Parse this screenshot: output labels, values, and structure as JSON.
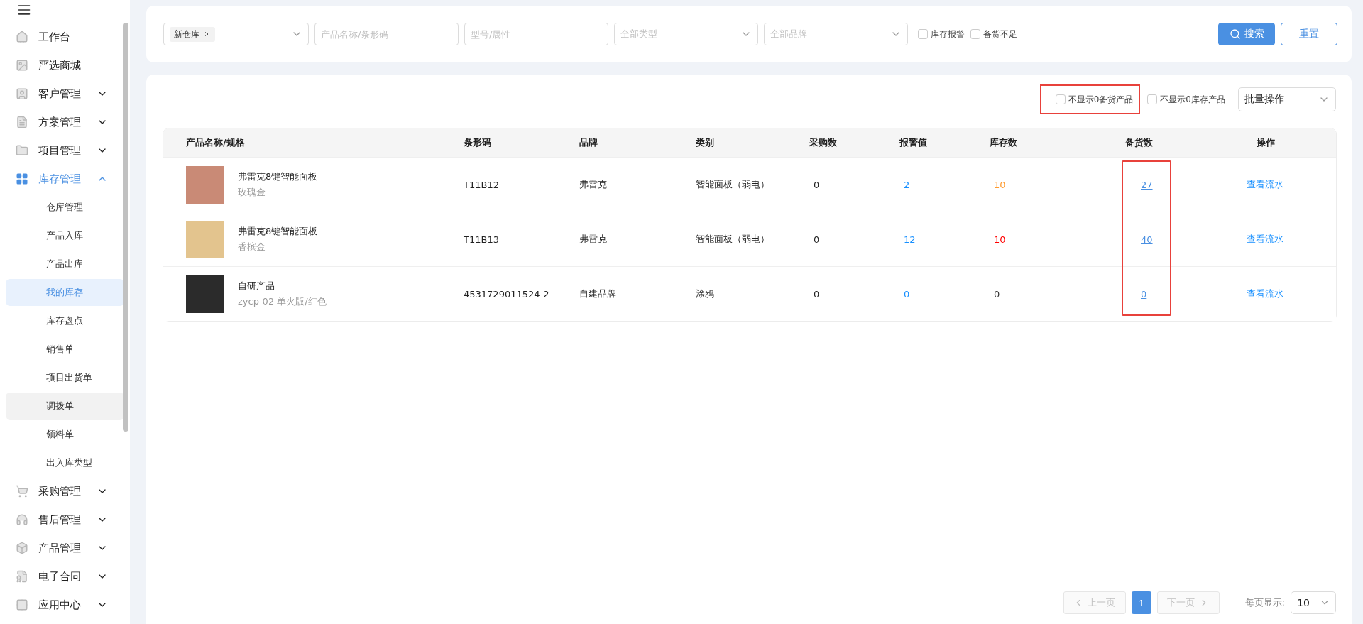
{
  "sidebar": {
    "items": [
      {
        "label": "工作台",
        "active": false
      },
      {
        "label": "严选商城",
        "active": false
      },
      {
        "label": "客户管理",
        "expanded": false,
        "active": false
      },
      {
        "label": "方案管理",
        "expanded": false,
        "active": false
      },
      {
        "label": "项目管理",
        "expanded": false,
        "active": false
      },
      {
        "label": "库存管理",
        "expanded": true,
        "active": true,
        "children": [
          {
            "label": "仓库管理",
            "selected": false,
            "hovered": false
          },
          {
            "label": "产品入库",
            "selected": false,
            "hovered": false
          },
          {
            "label": "产品出库",
            "selected": false,
            "hovered": false
          },
          {
            "label": "我的库存",
            "selected": true,
            "hovered": false
          },
          {
            "label": "库存盘点",
            "selected": false,
            "hovered": false
          },
          {
            "label": "销售单",
            "selected": false,
            "hovered": false
          },
          {
            "label": "项目出货单",
            "selected": false,
            "hovered": false
          },
          {
            "label": "调拨单",
            "selected": false,
            "hovered": true
          },
          {
            "label": "领料单",
            "selected": false,
            "hovered": false
          },
          {
            "label": "出入库类型",
            "selected": false,
            "hovered": false
          }
        ]
      },
      {
        "label": "采购管理",
        "expanded": false,
        "active": false
      },
      {
        "label": "售后管理",
        "expanded": false,
        "active": false
      },
      {
        "label": "产品管理",
        "expanded": false,
        "active": false
      },
      {
        "label": "电子合同",
        "expanded": false,
        "active": false
      },
      {
        "label": "应用中心",
        "expanded": false,
        "active": false
      }
    ]
  },
  "filters": {
    "warehouse_tag": "新仓库",
    "fields": [
      {
        "kind": "input",
        "placeholder": "产品名称/条形码"
      },
      {
        "kind": "input",
        "placeholder": "型号/属性"
      },
      {
        "kind": "select",
        "placeholder": "全部类型"
      },
      {
        "kind": "select",
        "placeholder": "全部品牌"
      }
    ],
    "checkboxes": [
      {
        "label": "库存报警",
        "checked": false
      },
      {
        "label": "备货不足",
        "checked": false
      }
    ],
    "buttons": [
      {
        "label": "搜索",
        "kind": "primary"
      },
      {
        "label": "重置",
        "kind": "secondary"
      }
    ]
  },
  "toolbar": {
    "options": [
      {
        "label": "不显示0备货产品",
        "checked": false,
        "highlighted": true
      },
      {
        "label": "不显示0库存产品",
        "checked": false,
        "highlighted": false
      }
    ],
    "batch_select": "批量操作"
  },
  "table": {
    "columns": [
      {
        "label": "产品名称/规格",
        "highlighted": false
      },
      {
        "label": "条形码",
        "highlighted": false
      },
      {
        "label": "品牌",
        "highlighted": false
      },
      {
        "label": "类别",
        "highlighted": false
      },
      {
        "label": "采购数",
        "highlighted": false
      },
      {
        "label": "报警值",
        "highlighted": false
      },
      {
        "label": "库存数",
        "highlighted": false
      },
      {
        "label": "备货数",
        "highlighted": true
      },
      {
        "label": "操作",
        "highlighted": false
      }
    ],
    "rows": [
      {
        "name": "弗雷克8键智能面板",
        "spec": "玫瑰金",
        "color": "#c98a76",
        "barcode": "T11B12",
        "brand": "弗雷克",
        "category": "智能面板（弱电）",
        "purchase": "0",
        "alert": "2",
        "stock": {
          "text": "10",
          "color": "#ff9a2e"
        },
        "reserve": "27",
        "action": "查看流水"
      },
      {
        "name": "弗雷克8键智能面板",
        "spec": "香槟金",
        "color": "#e3c48e",
        "barcode": "T11B13",
        "brand": "弗雷克",
        "category": "智能面板（弱电）",
        "purchase": "0",
        "alert": "12",
        "stock": {
          "text": "10",
          "color": "#ff0000"
        },
        "reserve": "40",
        "action": "查看流水"
      },
      {
        "name": "自研产品",
        "spec": "zycp-02 单火版/红色",
        "color": "#2b2b2b",
        "barcode": "4531729011524-2",
        "brand": "自建品牌",
        "category": "涂鸦",
        "purchase": "0",
        "alert": "0",
        "stock": {
          "text": "0",
          "color": "#333333"
        },
        "reserve": "0",
        "action": "查看流水"
      }
    ]
  },
  "pagination": {
    "prev": "上一页",
    "pages": [
      {
        "label": "1",
        "selected": true
      }
    ],
    "next": "下一页",
    "page_size_label": "每页显示:",
    "page_size": "10"
  }
}
